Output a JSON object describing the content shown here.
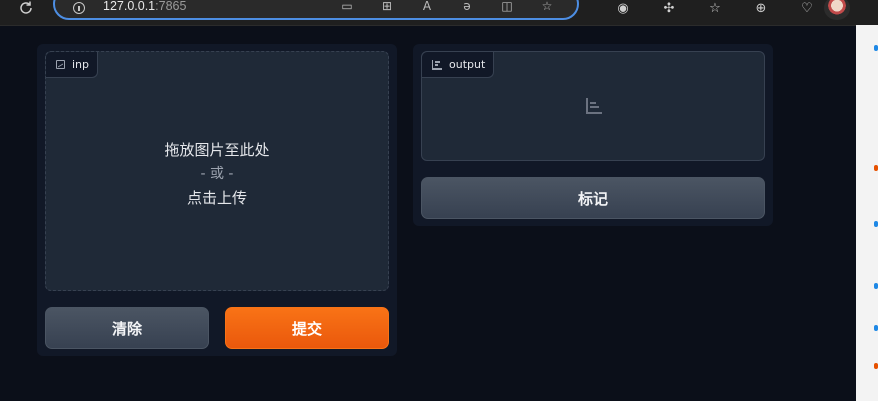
{
  "browser": {
    "url_host": "127.0.0.1",
    "url_port": ":7865",
    "icons": [
      "reload-icon",
      "info-icon",
      "app-install-icon",
      "grid-icon",
      "read-aloud-icon",
      "translate-icon",
      "split-screen-icon",
      "favorite-star-icon",
      "extension-icon",
      "puzzle-icon",
      "favorites-icon",
      "collections-icon",
      "heart-pulse-icon",
      "profile-avatar"
    ]
  },
  "input_panel": {
    "label": "inp",
    "drop_text": "拖放图片至此处",
    "or_text": "- 或 -",
    "click_text": "点击上传",
    "clear_button": "清除",
    "submit_button": "提交"
  },
  "output_panel": {
    "label": "output",
    "flag_button": "标记"
  },
  "colors": {
    "background": "#0b0f19",
    "panel": "#111827",
    "block": "#1f2937",
    "primary": "#f97316",
    "secondary": "#4b5563"
  }
}
